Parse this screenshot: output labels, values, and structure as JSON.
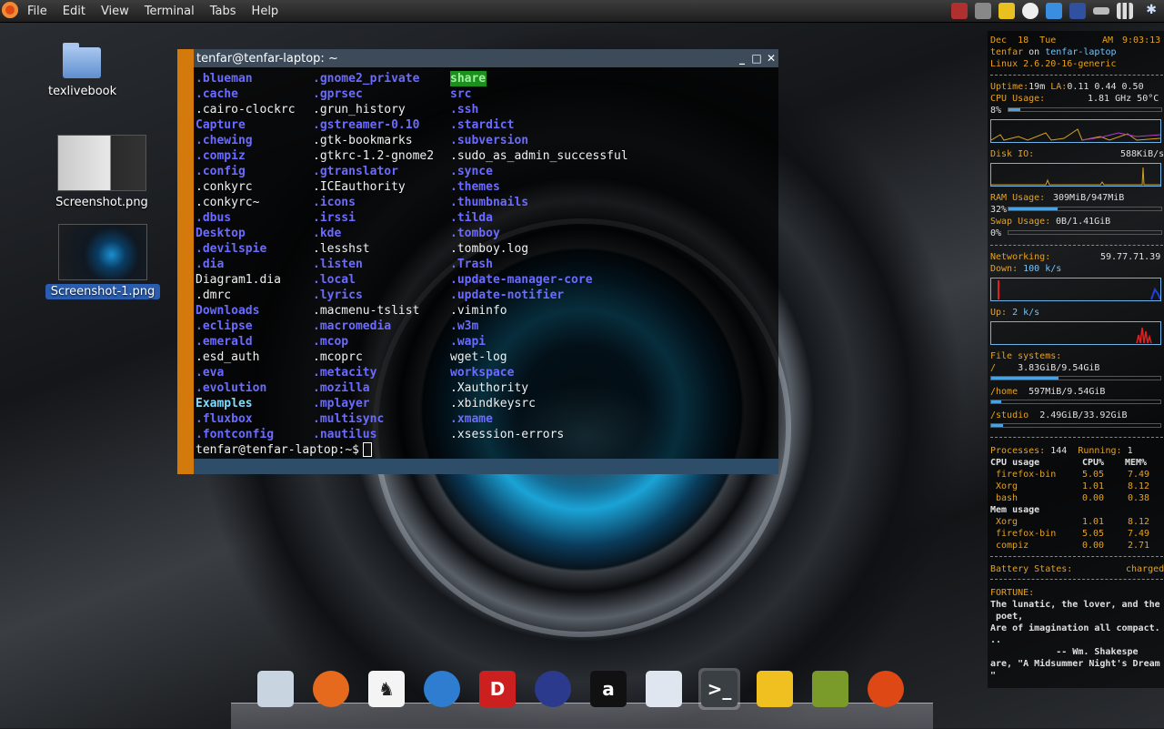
{
  "panel": {
    "menu": [
      "File",
      "Edit",
      "View",
      "Terminal",
      "Tabs",
      "Help"
    ]
  },
  "desktop": {
    "icons": [
      {
        "label": "texlivebook",
        "icon": "folder-icon"
      },
      {
        "label": "Screenshot.png",
        "icon": "image-thumbnail"
      },
      {
        "label": "Screenshot-1.png",
        "icon": "image-thumbnail",
        "selected": true
      }
    ]
  },
  "terminal": {
    "title": "tenfar@tenfar-laptop: ~",
    "controls": {
      "minimize": "_",
      "maximize": "□",
      "close": "✕"
    },
    "columns": [
      [
        {
          "name": ".blueman",
          "type": "dir"
        },
        {
          "name": ".cache",
          "type": "dir"
        },
        {
          "name": ".cairo-clockrc",
          "type": "file"
        },
        {
          "name": "Capture",
          "type": "dir"
        },
        {
          "name": ".chewing",
          "type": "dir"
        },
        {
          "name": ".compiz",
          "type": "dir"
        },
        {
          "name": ".config",
          "type": "dir"
        },
        {
          "name": ".conkyrc",
          "type": "file"
        },
        {
          "name": ".conkyrc~",
          "type": "file"
        },
        {
          "name": ".dbus",
          "type": "dir"
        },
        {
          "name": "Desktop",
          "type": "dir"
        },
        {
          "name": ".devilspie",
          "type": "dir"
        },
        {
          "name": ".dia",
          "type": "dir"
        },
        {
          "name": "Diagram1.dia",
          "type": "file"
        },
        {
          "name": ".dmrc",
          "type": "file"
        },
        {
          "name": "Downloads",
          "type": "dir"
        },
        {
          "name": ".eclipse",
          "type": "dir"
        },
        {
          "name": ".emerald",
          "type": "dir"
        },
        {
          "name": ".esd_auth",
          "type": "file"
        },
        {
          "name": ".eva",
          "type": "dir"
        },
        {
          "name": ".evolution",
          "type": "dir"
        },
        {
          "name": "Examples",
          "type": "special"
        },
        {
          "name": ".fluxbox",
          "type": "dir"
        },
        {
          "name": ".fontconfig",
          "type": "dir"
        }
      ],
      [
        {
          "name": ".gnome2_private",
          "type": "dir"
        },
        {
          "name": ".gprsec",
          "type": "dir"
        },
        {
          "name": ".grun_history",
          "type": "file"
        },
        {
          "name": ".gstreamer-0.10",
          "type": "dir"
        },
        {
          "name": ".gtk-bookmarks",
          "type": "file"
        },
        {
          "name": ".gtkrc-1.2-gnome2",
          "type": "file"
        },
        {
          "name": ".gtranslator",
          "type": "dir"
        },
        {
          "name": ".ICEauthority",
          "type": "file"
        },
        {
          "name": ".icons",
          "type": "dir"
        },
        {
          "name": ".irssi",
          "type": "dir"
        },
        {
          "name": ".kde",
          "type": "dir"
        },
        {
          "name": ".lesshst",
          "type": "file"
        },
        {
          "name": ".listen",
          "type": "dir"
        },
        {
          "name": ".local",
          "type": "dir"
        },
        {
          "name": ".lyrics",
          "type": "dir"
        },
        {
          "name": ".macmenu-tslist",
          "type": "file"
        },
        {
          "name": ".macromedia",
          "type": "dir"
        },
        {
          "name": ".mcop",
          "type": "dir"
        },
        {
          "name": ".mcoprc",
          "type": "file"
        },
        {
          "name": ".metacity",
          "type": "dir"
        },
        {
          "name": ".mozilla",
          "type": "dir"
        },
        {
          "name": ".mplayer",
          "type": "dir"
        },
        {
          "name": ".multisync",
          "type": "dir"
        },
        {
          "name": ".nautilus",
          "type": "dir"
        }
      ],
      [
        {
          "name": "share",
          "type": "highlight"
        },
        {
          "name": "src",
          "type": "dir"
        },
        {
          "name": ".ssh",
          "type": "dir"
        },
        {
          "name": ".stardict",
          "type": "dir"
        },
        {
          "name": ".subversion",
          "type": "dir"
        },
        {
          "name": ".sudo_as_admin_successful",
          "type": "file"
        },
        {
          "name": ".synce",
          "type": "dir"
        },
        {
          "name": ".themes",
          "type": "dir"
        },
        {
          "name": ".thumbnails",
          "type": "dir"
        },
        {
          "name": ".tilda",
          "type": "dir"
        },
        {
          "name": ".tomboy",
          "type": "dir"
        },
        {
          "name": ".tomboy.log",
          "type": "file"
        },
        {
          "name": ".Trash",
          "type": "dir"
        },
        {
          "name": ".update-manager-core",
          "type": "dir"
        },
        {
          "name": ".update-notifier",
          "type": "dir"
        },
        {
          "name": ".viminfo",
          "type": "file"
        },
        {
          "name": ".w3m",
          "type": "dir"
        },
        {
          "name": ".wapi",
          "type": "dir"
        },
        {
          "name": "wget-log",
          "type": "file"
        },
        {
          "name": "workspace",
          "type": "dir"
        },
        {
          "name": ".Xauthority",
          "type": "file"
        },
        {
          "name": ".xbindkeysrc",
          "type": "file"
        },
        {
          "name": ".xmame",
          "type": "dir"
        },
        {
          "name": ".xsession-errors",
          "type": "file"
        }
      ]
    ],
    "prompt": "tenfar@tenfar-laptop:~$"
  },
  "conky": {
    "date": "Dec  18  Tue",
    "ampm": "AM",
    "time": "9:03:13",
    "user": "tenfar",
    "on": "on",
    "host": "tenfar-laptop",
    "kernel": "Linux 2.6.20-16-generic",
    "uptime_label": "Uptime:",
    "uptime": "19m",
    "la_label": "LA:",
    "la": "0.11 0.44 0.50",
    "cpu_label": "CPU Usage:",
    "cpu_freq": "1.81 GHz 50°C",
    "cpu_pct": "8%",
    "cpu_fraction": 0.08,
    "disk_label": "Disk IO:",
    "disk_value": "588KiB/s",
    "ram_label": "RAM Usage:",
    "ram_value": "309MiB/947MiB",
    "ram_pct": "32%",
    "ram_fraction": 0.32,
    "swap_label": "Swap Usage:",
    "swap_value": "0B/1.41GiB",
    "swap_pct": "0%",
    "swap_fraction": 0.0,
    "net_label": "Networking:",
    "ip": "59.77.71.39",
    "down_label": "Down:",
    "down": "100 k/s",
    "up_label": "Up:",
    "up": "2 k/s",
    "fs_label": "File systems:",
    "fs": [
      {
        "mount": "/",
        "usage": "3.83GiB/9.54GiB",
        "fraction": 0.4
      },
      {
        "mount": "/home",
        "usage": "597MiB/9.54GiB",
        "fraction": 0.06
      },
      {
        "mount": "/studio",
        "usage": "2.49GiB/33.92GiB",
        "fraction": 0.07
      }
    ],
    "proc_label": "Processes:",
    "proc": "144",
    "running_label": "Running:",
    "running": "1",
    "cpu_table_label": "CPU usage",
    "cpu_col": "CPU%",
    "mem_col": "MEM%",
    "cpu_rows": [
      {
        "name": "firefox-bin",
        "cpu": "5.05",
        "mem": "7.49"
      },
      {
        "name": "Xorg",
        "cpu": "1.01",
        "mem": "8.12"
      },
      {
        "name": "bash",
        "cpu": "0.00",
        "mem": "0.38"
      }
    ],
    "mem_table_label": "Mem usage",
    "mem_rows": [
      {
        "name": "Xorg",
        "cpu": "1.01",
        "mem": "8.12"
      },
      {
        "name": "firefox-bin",
        "cpu": "5.05",
        "mem": "7.49"
      },
      {
        "name": "compiz",
        "cpu": "0.00",
        "mem": "2.71"
      }
    ],
    "battery_label": "Battery States:",
    "battery": "charged",
    "fortune_label": "FORTUNE:",
    "fortune": [
      "The lunatic, the lover, and the",
      " poet,",
      "Are of imagination all compact.",
      "..",
      "            -- Wm. Shakespe",
      "are, \"A Midsummer Night's Dream",
      "\""
    ]
  },
  "dock": {
    "items": [
      {
        "icon": "computer-icon",
        "glyph": "",
        "color": "#c8d4e0"
      },
      {
        "icon": "firefox-icon",
        "glyph": "",
        "color": "#e66a1e"
      },
      {
        "icon": "horse-icon",
        "glyph": "♞",
        "color": "#f4f4f4"
      },
      {
        "icon": "fish-icon",
        "glyph": "",
        "color": "#2e7dd0"
      },
      {
        "icon": "dictionary-icon",
        "glyph": "D",
        "color": "#cc1f1f"
      },
      {
        "icon": "eclipse-icon",
        "glyph": "",
        "color": "#2b3a8c"
      },
      {
        "icon": "amarok-icon",
        "glyph": "a",
        "color": "#111111"
      },
      {
        "icon": "mplayer-icon",
        "glyph": "",
        "color": "#dfe6f0"
      },
      {
        "icon": "terminal-icon",
        "glyph": ">_",
        "color": "#3a3f44"
      },
      {
        "icon": "photo-icon",
        "glyph": "",
        "color": "#f0c020"
      },
      {
        "icon": "books-icon",
        "glyph": "",
        "color": "#7a9a2a"
      },
      {
        "icon": "ubuntu-icon",
        "glyph": "",
        "color": "#dd4814"
      }
    ]
  }
}
